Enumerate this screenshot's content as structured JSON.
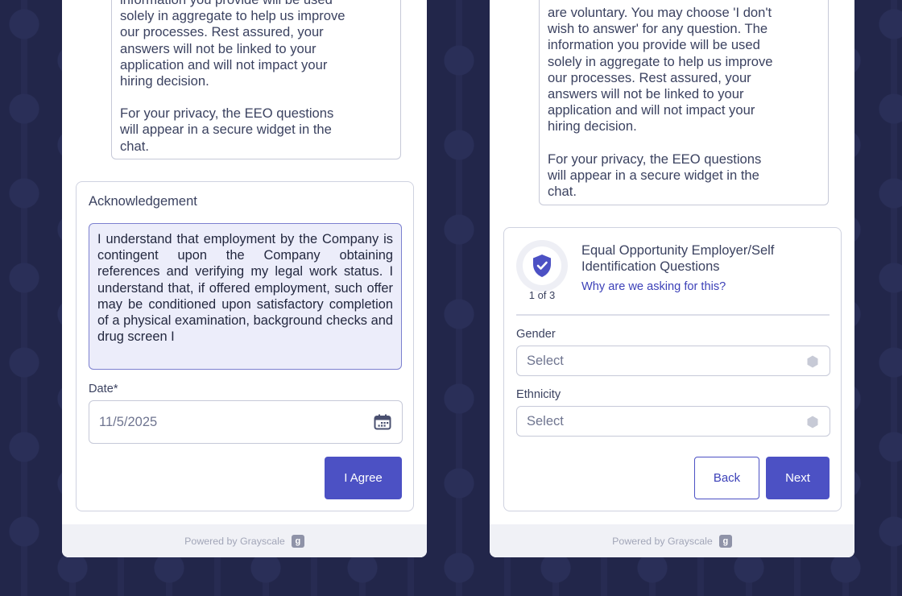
{
  "left_panel": {
    "info_paragraph_1_lines": [
      "information you provide will be used",
      "solely in aggregate to help us improve",
      "our processes. Rest assured, your",
      "answers will not be linked to your",
      "application and will not impact your",
      "hiring decision."
    ],
    "info_paragraph_2_lines": [
      "For your privacy, the EEO questions",
      "will appear in a secure widget in the",
      "chat."
    ],
    "acknowledgement": {
      "title": "Acknowledgement",
      "text": "I understand that employment by the Company is contingent upon the Company obtaining references and verifying my legal work status. I understand that, if offered employment, such offer may be conditioned upon satisfactory completion of a physical examination, background checks and drug screen I",
      "date_label": "Date*",
      "date_value": "11/5/2025",
      "agree_button": "I Agree"
    },
    "footer": {
      "text": "Powered by Grayscale",
      "logo_letter": "g"
    }
  },
  "right_panel": {
    "info_paragraph_1_lines": [
      "are voluntary. You may choose 'I don't",
      "wish to answer' for any question. The",
      "information you provide will be used",
      "solely in aggregate to help us improve",
      "our processes. Rest assured, your",
      "answers will not be linked to your",
      "application and will not impact your",
      "hiring decision."
    ],
    "info_paragraph_2_lines": [
      "For your privacy, the EEO questions",
      "will appear in a secure widget in the",
      "chat."
    ],
    "eeo": {
      "title_line_1": "Equal Opportunity Employer/Self",
      "title_line_2": "Identification Questions",
      "why_link": "Why are we asking for this?",
      "step": "1 of 3",
      "gender_label": "Gender",
      "gender_value": "Select",
      "ethnicity_label": "Ethnicity",
      "ethnicity_value": "Select",
      "back_button": "Back",
      "next_button": "Next"
    },
    "footer": {
      "text": "Powered by Grayscale",
      "logo_letter": "g"
    }
  },
  "colors": {
    "accent": "#4c51c4",
    "background": "#22264a",
    "ack_fill": "#ecedfa"
  },
  "icons": [
    "calendar-icon",
    "shield-check-icon",
    "dropdown-hex-icon",
    "grayscale-logo-icon"
  ]
}
